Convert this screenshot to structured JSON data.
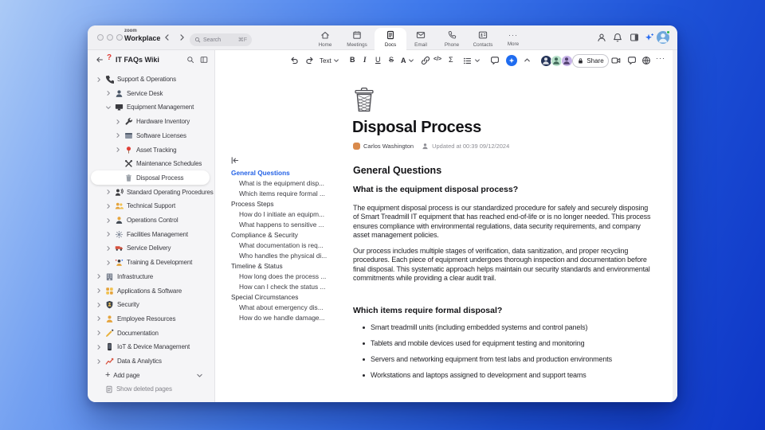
{
  "titlebar": {
    "logo_small": "zoom",
    "logo_main": "Workplace",
    "search_placeholder": "Search",
    "search_shortcut": "⌘F",
    "tabs": [
      {
        "label": "Home"
      },
      {
        "label": "Meetings"
      },
      {
        "label": "Docs"
      },
      {
        "label": "Email"
      },
      {
        "label": "Phone"
      },
      {
        "label": "Contacts"
      },
      {
        "label": "More"
      }
    ],
    "active_tab": "Docs"
  },
  "sidebar": {
    "title": "IT FAQs Wiki",
    "items": [
      {
        "label": "Support & Operations",
        "icon": "phone"
      },
      {
        "label": "Service Desk",
        "icon": "person-desk"
      },
      {
        "label": "Equipment Management",
        "icon": "monitor"
      },
      {
        "label": "Hardware Inventory",
        "icon": "wrench"
      },
      {
        "label": "Software Licenses",
        "icon": "software-window"
      },
      {
        "label": "Asset Tracking",
        "icon": "pushpin"
      },
      {
        "label": "Maintenance Schedules",
        "icon": "tools"
      },
      {
        "label": "Disposal Process",
        "icon": "trash",
        "selected": true
      },
      {
        "label": "Standard Operating Procedures",
        "icon": "speaking-head"
      },
      {
        "label": "Technical Support",
        "icon": "people"
      },
      {
        "label": "Operations Control",
        "icon": "operator"
      },
      {
        "label": "Facilities Management",
        "icon": "gear"
      },
      {
        "label": "Service Delivery",
        "icon": "truck"
      },
      {
        "label": "Training & Development",
        "icon": "juggler"
      },
      {
        "label": "Infrastructure",
        "icon": "building"
      },
      {
        "label": "Applications & Software",
        "icon": "app-grid"
      },
      {
        "label": "Security",
        "icon": "shield"
      },
      {
        "label": "Employee Resources",
        "icon": "person"
      },
      {
        "label": "Documentation",
        "icon": "pencil"
      },
      {
        "label": "IoT & Device Management",
        "icon": "mobile-device"
      },
      {
        "label": "Data & Analytics",
        "icon": "chart"
      }
    ],
    "add_page": "Add page",
    "show_deleted": "Show deleted pages"
  },
  "toolbar": {
    "text_style": "Text",
    "bold": "B",
    "italic": "I",
    "underline": "U",
    "strikethrough": "S",
    "color": "A",
    "code": "</>",
    "formula": "Σ",
    "more": "···",
    "share_label": "Share"
  },
  "toc": {
    "items": [
      {
        "label": "General Questions",
        "level": 0,
        "active": true
      },
      {
        "label": "What is the equipment disp...",
        "level": 1
      },
      {
        "label": "Which items require formal ...",
        "level": 1
      },
      {
        "label": "Process Steps",
        "level": 0
      },
      {
        "label": "How do I initiate an equipm...",
        "level": 1
      },
      {
        "label": "What happens to sensitive ...",
        "level": 1
      },
      {
        "label": "Compliance & Security",
        "level": 0
      },
      {
        "label": "What documentation is req...",
        "level": 1
      },
      {
        "label": "Who handles the physical di...",
        "level": 1
      },
      {
        "label": "Timeline & Status",
        "level": 0
      },
      {
        "label": "How long does the process ...",
        "level": 1
      },
      {
        "label": "How can I check the status ...",
        "level": 1
      },
      {
        "label": "Special Circumstances",
        "level": 0
      },
      {
        "label": "What about emergency dis...",
        "level": 1
      },
      {
        "label": "How do we handle damage...",
        "level": 1
      }
    ]
  },
  "doc": {
    "title": "Disposal Process",
    "author": "Carlos Washington",
    "updated": "Updated at 00:39 09/12/2024",
    "h2": "General Questions",
    "q1": "What is the equipment disposal process?",
    "p1": "The equipment disposal process is our standardized procedure for safely and securely disposing of Smart Treadmill IT equipment that has reached end-of-life or is no longer needed. This process ensures compliance with environmental regulations, data security requirements, and company asset management policies.",
    "p2": "Our process includes multiple stages of verification, data sanitization, and proper recycling procedures. Each piece of equipment undergoes thorough inspection and documentation before final disposal. This systematic approach helps maintain our security standards and environmental commitments while providing a clear audit trail.",
    "q2": "Which items require formal disposal?",
    "bullets": [
      "Smart treadmill units (including embedded systems and control panels)",
      "Tablets and mobile devices used for equipment testing and monitoring",
      "Servers and networking equipment from test labs and production environments",
      "Workstations and laptops assigned to development and support teams"
    ]
  }
}
